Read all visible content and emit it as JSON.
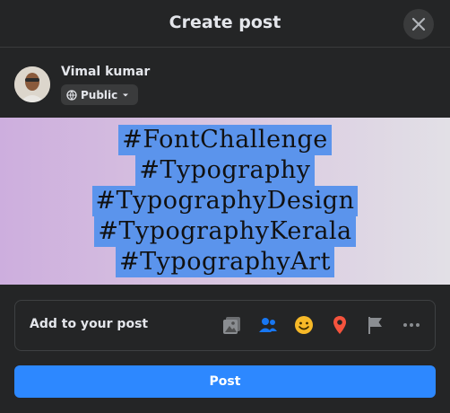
{
  "header": {
    "title": "Create post"
  },
  "user": {
    "name": "Vimal kumar",
    "audience_label": "Public"
  },
  "post": {
    "hashtags": [
      "#FontChallenge",
      "#Typography",
      "#TypographyDesign",
      "#TypographyKerala",
      "#TypographyArt"
    ],
    "background_colors": [
      "#cdaede",
      "#e2e0e6"
    ],
    "highlight_color": "#5b94ec"
  },
  "add_to_post": {
    "label": "Add to your post",
    "icons": [
      "photo-video-icon",
      "tag-people-icon",
      "feeling-activity-icon",
      "check-in-icon",
      "flag-icon",
      "more-icon"
    ]
  },
  "actions": {
    "post_label": "Post"
  },
  "colors": {
    "accent": "#2d88ff",
    "surface": "#242526",
    "control": "#3a3b3c"
  }
}
